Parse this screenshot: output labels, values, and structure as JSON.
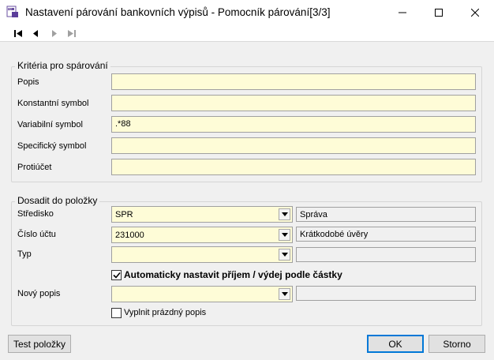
{
  "window": {
    "title": "Nastavení párování bankovních výpisů - Pomocník párování[3/3]"
  },
  "toolbar": {
    "items": [
      {
        "name": "first-record-button",
        "icon": "skip-first-icon"
      },
      {
        "name": "previous-record-button",
        "icon": "previous-icon"
      },
      {
        "name": "next-record-button",
        "icon": "next-icon"
      },
      {
        "name": "last-record-button",
        "icon": "skip-last-icon"
      }
    ]
  },
  "criteria": {
    "title": "Kritéria pro spárování",
    "fields": [
      {
        "label": "Popis",
        "value": ""
      },
      {
        "label": "Konstantní symbol",
        "value": ""
      },
      {
        "label": "Variabilní symbol",
        "value": ".*88"
      },
      {
        "label": "Specifický symbol",
        "value": ""
      },
      {
        "label": "Protiúčet",
        "value": ""
      }
    ]
  },
  "fill": {
    "title": "Dosadit do položky",
    "rows": [
      {
        "label": "Středisko",
        "value": "SPR",
        "description": "Správa"
      },
      {
        "label": "Číslo účtu",
        "value": "231000",
        "description": "Krátkodobé úvěry"
      },
      {
        "label": "Typ",
        "value": "",
        "description": ""
      }
    ],
    "auto_checkbox": {
      "label": "Automaticky nastavit příjem / výdej podle částky",
      "checked": true
    },
    "new_description": {
      "label": "Nový popis",
      "value": "",
      "description": ""
    },
    "empty_checkbox": {
      "label": "Vyplnit prázdný popis",
      "checked": false
    }
  },
  "buttons": {
    "test": "Test položky",
    "ok": "OK",
    "cancel": "Storno"
  },
  "colors": {
    "input_background": "#fefcd7",
    "default_button_border": "#0078d7"
  }
}
